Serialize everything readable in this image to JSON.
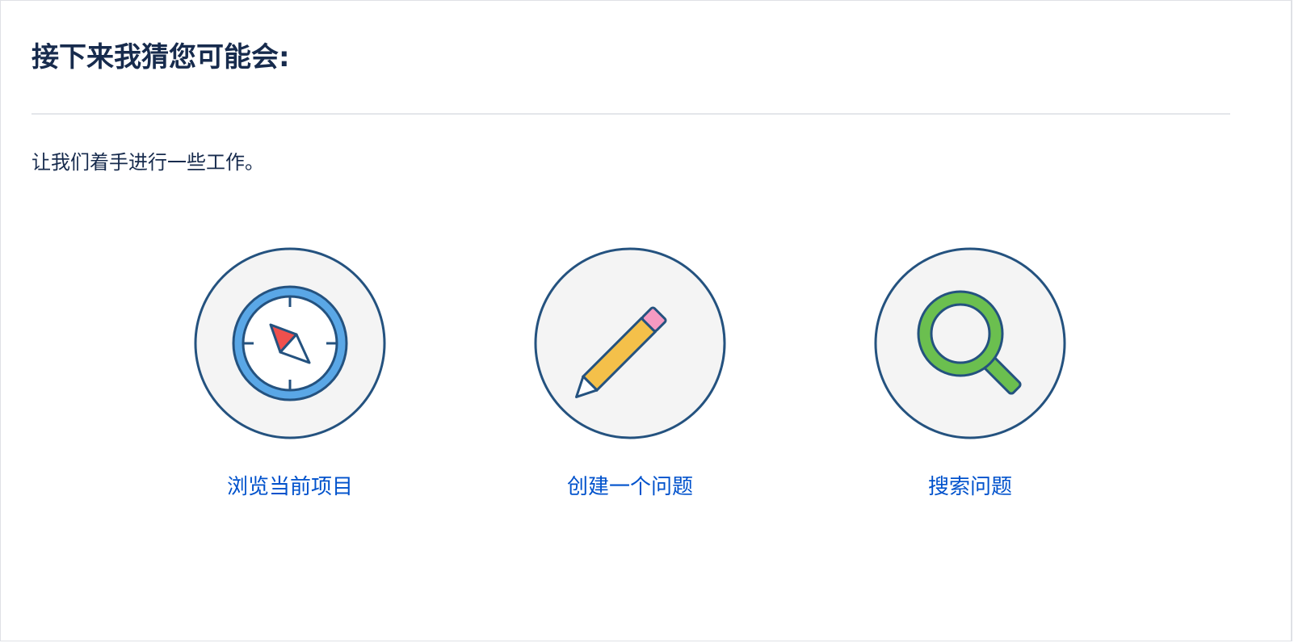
{
  "panel": {
    "heading": "接下来我猜您可能会:",
    "intro": "让我们着手进行一些工作。"
  },
  "actions": [
    {
      "label": "浏览当前项目",
      "icon": "compass-icon"
    },
    {
      "label": "创建一个问题",
      "icon": "pencil-icon"
    },
    {
      "label": "搜索问题",
      "icon": "magnifier-icon"
    }
  ],
  "colors": {
    "heading_text": "#172b4d",
    "link": "#0052cc",
    "icon_outline": "#24527f",
    "icon_bg": "#f4f4f4",
    "compass_ring": "#5aa7e6",
    "compass_needle": "#f0504d",
    "pencil_body": "#f4c04a",
    "pencil_eraser": "#f49ac2",
    "magnifier": "#6bbf4f"
  }
}
